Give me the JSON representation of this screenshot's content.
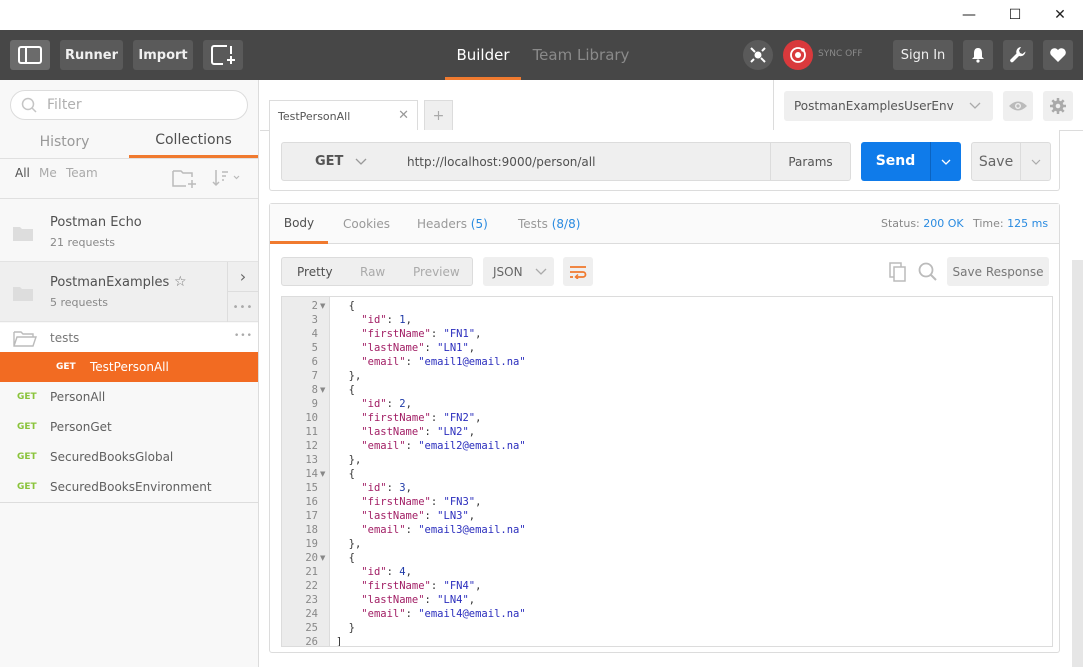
{
  "window": {
    "minimize": "—",
    "maximize": "☐",
    "close": "✕"
  },
  "topbar": {
    "runner_label": "Runner",
    "import_label": "Import",
    "tabs": [
      {
        "label": "Builder",
        "active": true
      },
      {
        "label": "Team Library",
        "active": false
      }
    ],
    "sync_label": "SYNC OFF",
    "sign_in_label": "Sign In",
    "accent": "#f07a2f"
  },
  "sidebar": {
    "filter_placeholder": "Filter",
    "tabs": [
      {
        "label": "History",
        "active": false
      },
      {
        "label": "Collections",
        "active": true
      }
    ],
    "filters": [
      "All",
      "Me",
      "Team"
    ],
    "collections": [
      {
        "name": "Postman Echo",
        "sub": "21 requests"
      },
      {
        "name": "PostmanExamples",
        "sub": "5 requests"
      }
    ],
    "folder": {
      "name": "tests"
    },
    "selected_request": {
      "method": "GET",
      "name": "TestPersonAll"
    },
    "requests": [
      {
        "method": "GET",
        "name": "PersonAll"
      },
      {
        "method": "GET",
        "name": "PersonGet"
      },
      {
        "method": "GET",
        "name": "SecuredBooksGlobal"
      },
      {
        "method": "GET",
        "name": "SecuredBooksEnvironment"
      }
    ]
  },
  "main": {
    "tab_label": "TestPersonAll",
    "add_tab": "+",
    "environment": "PostmanExamplesUserEnv",
    "method": "GET",
    "url": "http://localhost:9000/person/all",
    "params_label": "Params",
    "send_label": "Send",
    "save_label": "Save",
    "send_color": "#0f7bea",
    "response": {
      "tabs": [
        {
          "label": "Body",
          "count": ""
        },
        {
          "label": "Cookies",
          "count": ""
        },
        {
          "label": "Headers",
          "count": "(5)"
        },
        {
          "label": "Tests",
          "count": "(8/8)"
        }
      ],
      "status_label": "Status:",
      "status_value": "200 OK",
      "time_label": "Time:",
      "time_value": "125 ms",
      "views": [
        "Pretty",
        "Raw",
        "Preview"
      ],
      "format": "JSON",
      "save_response_label": "Save Response",
      "lines": [
        {
          "n": "2",
          "fold": true,
          "t": "  {"
        },
        {
          "n": "3",
          "t": "    \"id\": 1,"
        },
        {
          "n": "4",
          "t": "    \"firstName\": \"FN1\","
        },
        {
          "n": "5",
          "t": "    \"lastName\": \"LN1\","
        },
        {
          "n": "6",
          "t": "    \"email\": \"email1@email.na\""
        },
        {
          "n": "7",
          "t": "  },"
        },
        {
          "n": "8",
          "fold": true,
          "t": "  {"
        },
        {
          "n": "9",
          "t": "    \"id\": 2,"
        },
        {
          "n": "10",
          "t": "    \"firstName\": \"FN2\","
        },
        {
          "n": "11",
          "t": "    \"lastName\": \"LN2\","
        },
        {
          "n": "12",
          "t": "    \"email\": \"email2@email.na\""
        },
        {
          "n": "13",
          "t": "  },"
        },
        {
          "n": "14",
          "fold": true,
          "t": "  {"
        },
        {
          "n": "15",
          "t": "    \"id\": 3,"
        },
        {
          "n": "16",
          "t": "    \"firstName\": \"FN3\","
        },
        {
          "n": "17",
          "t": "    \"lastName\": \"LN3\","
        },
        {
          "n": "18",
          "t": "    \"email\": \"email3@email.na\""
        },
        {
          "n": "19",
          "t": "  },"
        },
        {
          "n": "20",
          "fold": true,
          "t": "  {"
        },
        {
          "n": "21",
          "t": "    \"id\": 4,"
        },
        {
          "n": "22",
          "t": "    \"firstName\": \"FN4\","
        },
        {
          "n": "23",
          "t": "    \"lastName\": \"LN4\","
        },
        {
          "n": "24",
          "t": "    \"email\": \"email4@email.na\""
        },
        {
          "n": "25",
          "t": "  }"
        },
        {
          "n": "26",
          "t": "]"
        }
      ]
    }
  }
}
